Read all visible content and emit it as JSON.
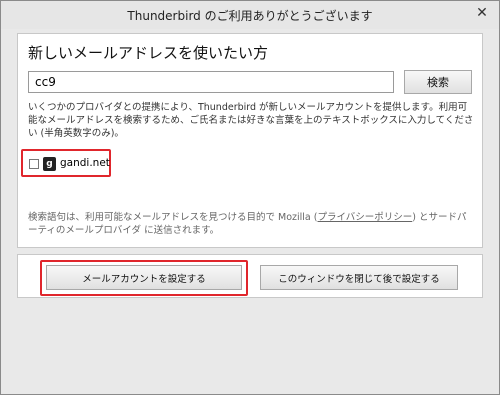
{
  "window": {
    "title": "Thunderbird のご利用ありがとうございます",
    "close_glyph": "✕"
  },
  "search_section": {
    "heading": "新しいメールアドレスを使いたい方",
    "input_value": "cc9",
    "search_button_label": "検索",
    "info_text": "いくつかのプロバイダとの提携により、Thunderbird が新しいメールアカウントを提供します。利用可能なメールアドレスを検索するため、ご氏名または好きな言葉を上のテキストボックスに入力してください (半角英数字のみ)。",
    "provider": {
      "logo_letter": "g",
      "name": "gandi.net",
      "checked": false
    },
    "footer_note_before": "検索語句は、利用可能なメールアドレスを見つける目的で Mozilla (",
    "privacy_link": "プライバシーポリシー",
    "footer_note_after": ") とサードパーティのメールプロバイダ に送信されます。"
  },
  "actions": {
    "setup_button_label": "メールアカウントを設定する",
    "later_button_label": "このウィンドウを閉じて後で設定する"
  },
  "colors": {
    "highlight": "#e0262c",
    "window_bg": "#e9e9e9"
  }
}
